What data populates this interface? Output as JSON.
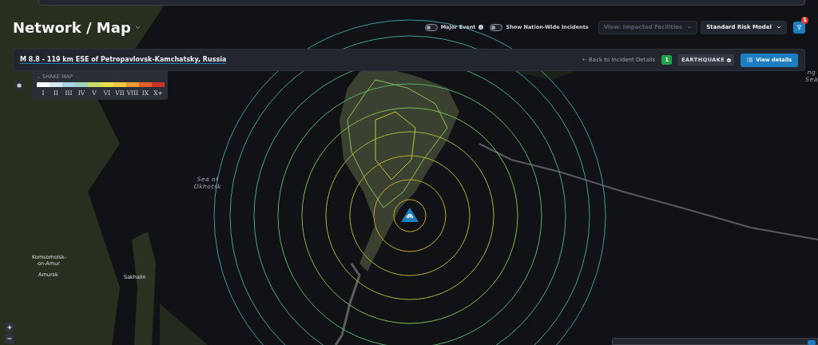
{
  "page": {
    "title": "Network / Map"
  },
  "toggles": [
    {
      "label": "Major Event",
      "on": false,
      "info": true
    },
    {
      "label": "Show Nation-Wide Incidents",
      "on": false,
      "info": false
    }
  ],
  "dropdowns": [
    {
      "label": "View: Impacted Facilities",
      "disabled": true
    },
    {
      "label": "Standard Risk Model",
      "disabled": false
    }
  ],
  "filter": {
    "badge": "1"
  },
  "incident": {
    "title": "M 8.8 - 119 km ESE of Petropavlovsk-Kamchatsky, Russia",
    "back_link": "← Back to Incident Details",
    "count": "1",
    "type": "EARTHQUAKE",
    "button": "View details"
  },
  "shake_map": {
    "title": "SHAKE MAP",
    "expanded": true,
    "levels": [
      {
        "label": "I",
        "color": "#ffffff"
      },
      {
        "label": "II",
        "color": "#d6e6f2"
      },
      {
        "label": "III",
        "color": "#aad3e6"
      },
      {
        "label": "IV",
        "color": "#9fd6c2"
      },
      {
        "label": "V",
        "color": "#c8e06a"
      },
      {
        "label": "VI",
        "color": "#e8e04a"
      },
      {
        "label": "VII",
        "color": "#f2c843"
      },
      {
        "label": "VIII",
        "color": "#eb9a35"
      },
      {
        "label": "IX",
        "color": "#e0602c"
      },
      {
        "label": "X+",
        "color": "#c8352a"
      }
    ]
  },
  "map_labels": [
    {
      "kind": "sea",
      "text": "Sea of Okhotsk"
    },
    {
      "kind": "place",
      "text": "Komsomolsk-on-Amur"
    },
    {
      "kind": "place",
      "text": "Amursk"
    },
    {
      "kind": "place",
      "text": "Sakhalin"
    },
    {
      "kind": "sea",
      "text": "ng Sea"
    }
  ]
}
